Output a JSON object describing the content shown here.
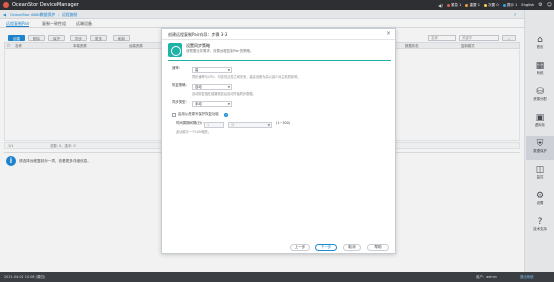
{
  "app": {
    "name": "OceanStor DeviceManager"
  },
  "topbar": {
    "items": [
      {
        "label": "紧急 1",
        "color": "#e05b4b"
      },
      {
        "label": "重要 1",
        "color": "#f0a030"
      },
      {
        "label": "次要 0",
        "color": "#f7d44a"
      },
      {
        "label": "提示 1",
        "color": "#3aa0e0"
      },
      {
        "label": "English",
        "color": "#aab0b8"
      }
    ]
  },
  "breadcrumb": {
    "device": "OceanStor 6800",
    "section": "数据保护",
    "page": "远程复制"
  },
  "tabs": [
    {
      "label": "远程复制Pair",
      "active": true
    },
    {
      "label": "复制一致性组",
      "active": false
    },
    {
      "label": "远端设备",
      "active": false
    }
  ],
  "toolbar": {
    "create": "创建",
    "delete": "删除",
    "protect": "保护",
    "sync": "同步",
    "more": "更多",
    "refresh": "刷新",
    "filter": "名称",
    "search_placeholder": "关键字"
  },
  "grid": {
    "columns": [
      "名称",
      "本端资源",
      "远端资源",
      "数据状态",
      "复制模式"
    ],
    "footer_page": "1/1",
    "footer_count": "总数: 0，选中: 0"
  },
  "detail": {
    "hint": "请选择远程复制对一项，查看更多详细信息。"
  },
  "sidebar": [
    {
      "label": "首页",
      "icon": "home-icon",
      "glyph": "⌂",
      "active": false
    },
    {
      "label": "系统",
      "icon": "system-icon",
      "glyph": "▦",
      "active": false
    },
    {
      "label": "资源分配",
      "icon": "provisioning-icon",
      "glyph": "⛁",
      "active": false
    },
    {
      "label": "虚拟化",
      "icon": "virtualization-icon",
      "glyph": "▣",
      "active": false
    },
    {
      "label": "数据保护",
      "icon": "data-protection-icon",
      "glyph": "⛨",
      "active": true
    },
    {
      "label": "监控",
      "icon": "monitor-icon",
      "glyph": "◫",
      "active": false
    },
    {
      "label": "设置",
      "icon": "settings-icon",
      "glyph": "⚙",
      "active": false
    },
    {
      "label": "技术支持",
      "icon": "support-icon",
      "glyph": "?",
      "active": false
    }
  ],
  "statusbar": {
    "time": "2021-04-01 10:08 (周四)",
    "user": "用户：admin",
    "logout": "退出系统"
  },
  "dialog": {
    "title": "创建远程复制Pair向导：步骤 3-3",
    "close": "×",
    "step_title": "设置同步策略",
    "step_subtitle": "请根据业务需求，设置远程复制Pair的策略。",
    "progress": 1.0,
    "rate_label": "速率：",
    "rate_value": "高",
    "rate_help": "同步速率与CPU、可靠性业务之间关系，建议设置为高以减少对主机的影响。",
    "recovery_label": "恢复策略：",
    "recovery_value": "自动",
    "recovery_help": "自动恢复指在链路恢复后自动开始同步数据。",
    "sync_label": "同步类型：",
    "sync_value": "手动",
    "checkbox_label": "启用从资源写保护恢复功能",
    "period_label": "时间周期间隔(分)：",
    "period_value": "1",
    "period_unit": "分",
    "period_range": "(1~300)",
    "period_help": "此功能与一个LUN相关。",
    "buttons": {
      "prev": "上一步",
      "next": "下一步",
      "cancel": "取消",
      "help": "帮助"
    }
  }
}
